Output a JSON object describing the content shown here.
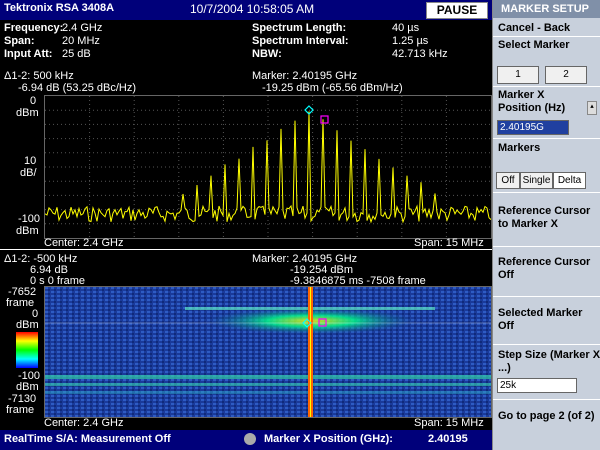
{
  "header": {
    "brand": "Tektronix  RSA 3408A",
    "datetime": "10/7/2004 10:58:05 AM",
    "pause_label": "PAUSE"
  },
  "params": {
    "frequency_label": "Frequency:",
    "frequency": "2.4 GHz",
    "span_label": "Span:",
    "span": "20 MHz",
    "input_att_label": "Input Att:",
    "input_att": "25 dB",
    "spectrum_length_label": "Spectrum Length:",
    "spectrum_length": "40 µs",
    "spectrum_interval_label": "Spectrum Interval:",
    "spectrum_interval": "1.25 µs",
    "nbw_label": "NBW:",
    "nbw": "42.713 kHz"
  },
  "spectrum": {
    "delta_line1": "Δ1-2: 500 kHz",
    "delta_line2": "-6.94 dB (53.25 dBc/Hz)",
    "marker_line1": "Marker: 2.40195 GHz",
    "marker_line2": "-19.25 dBm (-65.56 dBm/Hz)",
    "ytop": "0",
    "yunit_top": "dBm",
    "ydiv": "10",
    "ydiv_unit": "dB/",
    "ybottom": "-100",
    "yunit_bottom": "dBm",
    "center": "Center: 2.4 GHz",
    "span": "Span: 15 MHz"
  },
  "spectrogram": {
    "delta_line1": "Δ1-2: -500 kHz",
    "delta_line2": "6.94 dB",
    "delta_line3": "0 s  0 frame",
    "marker_line1": "Marker: 2.40195 GHz",
    "marker_line2": "-19.254 dBm",
    "marker_line3": "-9.3846875 ms  -7508 frame",
    "y_top": "-7652",
    "y_top_unit": "frame",
    "y_zero": "0",
    "y_zero_unit": "dBm",
    "y_m100": "-100",
    "y_m100_unit": "dBm",
    "y_bottom": "-7130",
    "y_bottom_unit": "frame",
    "center": "Center: 2.4 GHz",
    "span": "Span: 15 MHz"
  },
  "status": {
    "mode": "RealTime S/A: Measurement Off",
    "knob_label": "Marker X Position (GHz):",
    "knob_value": "2.40195"
  },
  "side_panel": {
    "title": "MARKER SETUP",
    "cancel": "Cancel - Back",
    "select_marker": "Select Marker",
    "marker_1": "1",
    "marker_2": "2",
    "marker_x_label": "Marker X Position (Hz)",
    "marker_x_value": "2.40195G",
    "markers_label": "Markers",
    "off": "Off",
    "single": "Single",
    "delta": "Delta",
    "ref_to_marker": "Reference Cursor to Marker X",
    "ref_off": "Reference Cursor Off",
    "selected_off": "Selected Marker Off",
    "step_label": "Step Size (Marker X ...)",
    "step_value": "25k",
    "go_page": "Go to page 2 (of 2)"
  },
  "colors": {
    "trace": "#ffff00",
    "title_bar": "#00007a",
    "side_bg": "#c8d0dc",
    "marker1": "#00ffff",
    "marker2": "#ff00ff"
  }
}
